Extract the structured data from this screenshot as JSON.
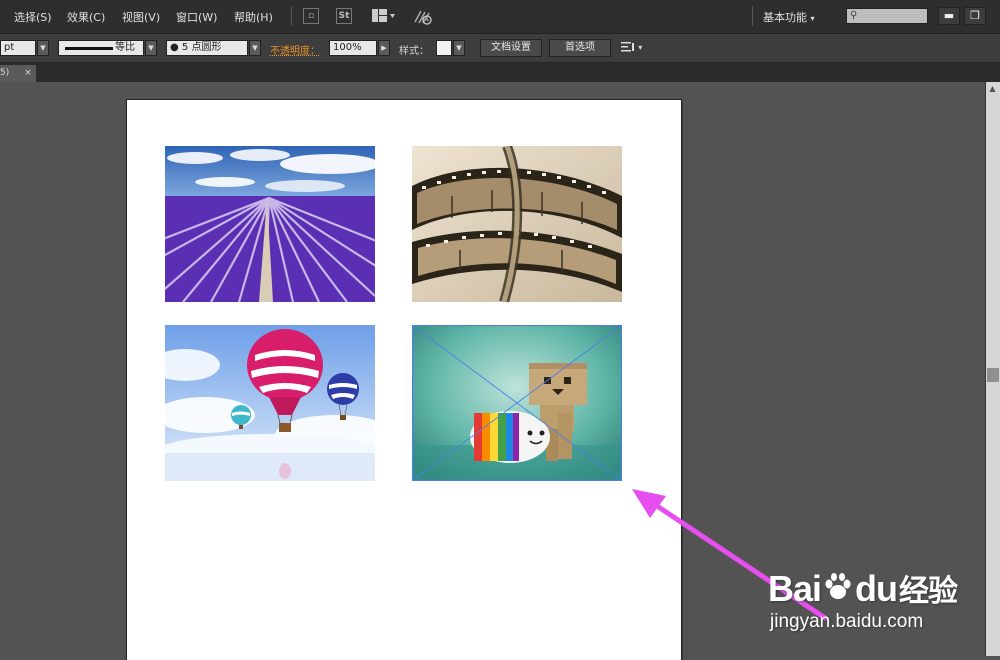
{
  "menu": {
    "items": [
      "选择(S)",
      "效果(C)",
      "视图(V)",
      "窗口(W)",
      "帮助(H)"
    ],
    "st_label": "St",
    "workspace": "基本功能",
    "search_value": "",
    "minimize": "▬",
    "restore": "❐"
  },
  "control_bar": {
    "unit": "pt",
    "stroke_profile": "等比",
    "brush": "● 5 点圆形",
    "opacity_label": "不透明度：",
    "opacity_value": "100%",
    "style_label": "样式：",
    "doc_setup": "文档设置",
    "preferences": "首选项",
    "opacity_color": "#e8912d"
  },
  "tab": {
    "label": "5)",
    "close": "×"
  },
  "canvas": {
    "artboard_color": "#ffffff",
    "selection_color": "#4a7fe8",
    "images": [
      "lavender-field-photo",
      "film-strip-photo",
      "hot-air-balloons-photo",
      "danbo-figure-photo"
    ],
    "arrow_color": "#e64ef0"
  },
  "watermark": {
    "brand_left": "Bai",
    "brand_right": "du",
    "brand_cn": "经验",
    "url": "jingyan.baidu.com"
  }
}
